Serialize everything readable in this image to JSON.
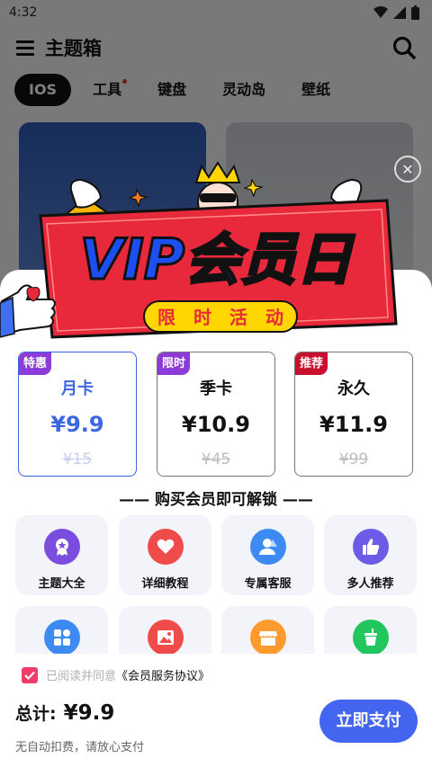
{
  "status": {
    "time": "4:32"
  },
  "appbar": {
    "title": "主题箱"
  },
  "tabs": [
    {
      "label": "IOS",
      "active": true
    },
    {
      "label": "工具",
      "dot": true
    },
    {
      "label": "键盘"
    },
    {
      "label": "灵动岛"
    },
    {
      "label": "壁纸"
    }
  ],
  "banner": {
    "title": "VIP会员日",
    "subtitle": [
      "限",
      "时",
      "活",
      "动"
    ]
  },
  "plans": [
    {
      "badge": "特惠",
      "badge_color": "#8c3bd9",
      "name": "月卡",
      "price": "¥9.9",
      "old_price": "¥15",
      "selected": true
    },
    {
      "badge": "限时",
      "badge_color": "#8c3bd9",
      "name": "季卡",
      "price": "¥10.9",
      "old_price": "¥45",
      "selected": false
    },
    {
      "badge": "推荐",
      "badge_color": "#c8102e",
      "name": "永久",
      "price": "¥11.9",
      "old_price": "¥99",
      "selected": false
    }
  ],
  "unlock_title": "—— 购买会员即可解锁 ——",
  "features": [
    {
      "label": "主题大全",
      "icon": "award-icon",
      "color": "#7b4dde"
    },
    {
      "label": "详细教程",
      "icon": "heart-icon",
      "color": "#ef4b4b"
    },
    {
      "label": "专属客服",
      "icon": "user-icon",
      "color": "#3d8bf2"
    },
    {
      "label": "多人推荐",
      "icon": "thumbs-up-icon",
      "color": "#6b5be6"
    },
    {
      "label": "",
      "icon": "grid-icon",
      "color": "#3d8bf2"
    },
    {
      "label": "",
      "icon": "image-icon",
      "color": "#ef4b4b"
    },
    {
      "label": "",
      "icon": "store-icon",
      "color": "#ff9a2e"
    },
    {
      "label": "",
      "icon": "cup-icon",
      "color": "#22c55e"
    }
  ],
  "footer": {
    "agree_prefix": "已阅读并同意",
    "agree_link": "《会员服务协议》",
    "total_label": "总计:",
    "total_value": "¥9.9",
    "no_deduct": "无自动扣费，请放心支付",
    "pay_label": "立即支付"
  }
}
